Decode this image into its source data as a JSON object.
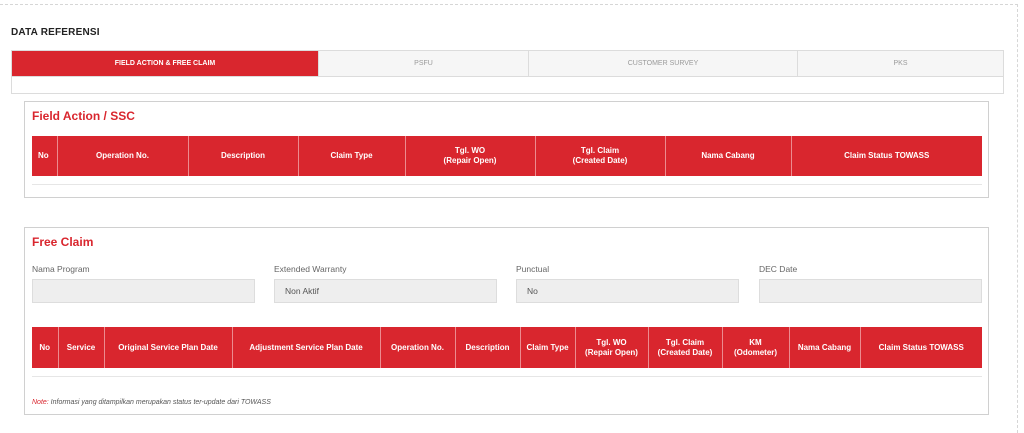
{
  "page": {
    "section_title": "DATA REFERENSI"
  },
  "tabs": [
    {
      "label": "FIELD ACTION & FREE CLAIM",
      "active": true
    },
    {
      "label": "PSFU",
      "active": false
    },
    {
      "label": "CUSTOMER SURVEY",
      "active": false
    },
    {
      "label": "PKS",
      "active": false
    }
  ],
  "field_action": {
    "title": "Field Action / SSC",
    "columns": [
      "No",
      "Operation No.",
      "Description",
      "Claim Type",
      "Tgl. WO\n(Repair Open)",
      "Tgl. Claim\n(Created Date)",
      "Nama Cabang",
      "Claim Status TOWASS"
    ]
  },
  "free_claim": {
    "title": "Free Claim",
    "fields": [
      {
        "label": "Nama Program",
        "value": ""
      },
      {
        "label": "Extended Warranty",
        "value": "Non Aktif"
      },
      {
        "label": "Punctual",
        "value": "No"
      },
      {
        "label": "DEC Date",
        "value": ""
      }
    ],
    "columns": [
      "No",
      "Service",
      "Original Service Plan Date",
      "Adjustment Service Plan Date",
      "Operation No.",
      "Description",
      "Claim Type",
      "Tgl. WO\n(Repair Open)",
      "Tgl. Claim\n(Created Date)",
      "KM\n(Odometer)",
      "Nama Cabang",
      "Claim Status TOWASS"
    ],
    "note_label": "Note:",
    "note_text": " Informasi yang ditampilkan merupakan status ter-update dari TOWASS"
  },
  "colors": {
    "accent": "#d9262e",
    "tab_inactive": "#f6f6f6"
  }
}
